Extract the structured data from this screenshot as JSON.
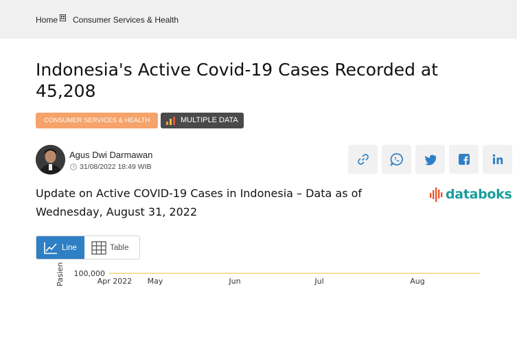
{
  "breadcrumb": {
    "home": "Home",
    "category": "Consumer Services & Health"
  },
  "article": {
    "title": "Indonesia's Active Covid-19 Cases Recorded at 45,208",
    "category_badge": "CONSUMER SERVICES & HEALTH",
    "multi_badge": "MULTIPLE DATA",
    "author": "Agus Dwi Darmawan",
    "date": "31/08/2022 18:49 WIB"
  },
  "share": [
    "link-icon",
    "whatsapp-icon",
    "twitter-icon",
    "facebook-icon",
    "linkedin-icon"
  ],
  "chart_section": {
    "subtitle": "Update on Active COVID-19 Cases in Indonesia – Data as of Wednesday, August 31, 2022",
    "logo": "databoks",
    "toggle": {
      "line": "Line",
      "table": "Table"
    }
  },
  "chart_data": {
    "type": "line",
    "ylabel": "Pasien",
    "yticks": [
      "100,000"
    ],
    "xticks": [
      "Apr 2022",
      "May",
      "Jun",
      "Jul",
      "Aug"
    ],
    "grid": true
  },
  "colors": {
    "accent": "#2f7fc4",
    "category_badge": "#f5a36a",
    "grid_line": "#f2d27a",
    "logo": "#1a9d9d"
  }
}
